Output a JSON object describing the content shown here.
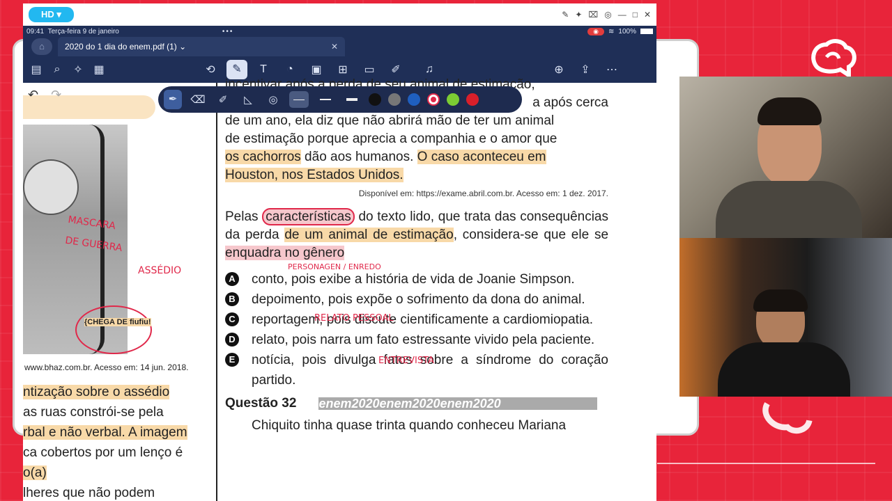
{
  "stream": {
    "hd_label": "HD ▾"
  },
  "status_bar": {
    "time": "09:41",
    "date": "Terça-feira 9 de janeiro",
    "battery": "100%"
  },
  "tab": {
    "title": "2020 do 1 dia do enem.pdf (1)"
  },
  "left_column": {
    "source": "www.bhaz.com.br. Acesso em: 14 jun. 2018.",
    "text_lines": [
      "ntização sobre o assédio",
      "as ruas constrói-se pela",
      "rbal e não verbal. A imagem",
      "ca cobertos por um lenço é",
      "o(a)",
      "lheres que não podem"
    ],
    "annotations": [
      "MASCARA DE GUERRA",
      "ASSÉDIO",
      "{CHEGA DE fiufiu!"
    ]
  },
  "passage": {
    "line1": "incentivar após a perda de seu animal de estimação,",
    "line2": "a após cerca",
    "line3": "de um ano, ela diz que não abrirá mão de ter um animal",
    "line4": "de estimação porque aprecia a companhia e o amor que",
    "line5_a": "os cachorros",
    "line5_b": " dão aos humanos. ",
    "line5_c": "O caso aconteceu em",
    "line6": "Houston, nos Estados Unidos.",
    "source": "Disponível em: https://exame.abril.com.br. Acesso em: 1 dez. 2017."
  },
  "question": {
    "part1": "Pelas ",
    "highlight1": "características",
    "part2": " do texto lido, que trata das consequências da perda ",
    "highlight2": "de um animal de estimação",
    "part3": ", considera-se que ele se ",
    "highlight3": "enquadra no gênero"
  },
  "options": [
    {
      "letter": "A",
      "text": "conto, pois exibe a história de vida de Joanie Simpson."
    },
    {
      "letter": "B",
      "text": "depoimento, pois expõe o sofrimento da dona do animal."
    },
    {
      "letter": "C",
      "text": "reportagem, pois discute cientificamente a cardiomiopatia."
    },
    {
      "letter": "D",
      "text": "relato, pois narra um fato estressante vivido pela paciente."
    },
    {
      "letter": "E",
      "text": "notícia, pois divulga fatos sobre a síndrome do coração partido."
    }
  ],
  "annotations_right": {
    "a": "PERSONAGEN / ENREDO",
    "b": "RELATO PESSOAL",
    "c": "ENTREVISTA"
  },
  "next_question": {
    "title": "Questão 32",
    "band": "enem2020enem2020enem2020",
    "first_line": "Chiquito tinha quase trinta quando conheceu Mariana"
  },
  "colors": {
    "background": "#e8243a",
    "toolbar": "#1f2f57",
    "highlight": "#f8d9a8",
    "pen_colors": [
      "#111111",
      "#777777",
      "#1f5fbf",
      "#e0284a",
      "#7ccc33",
      "#d91f2a"
    ]
  }
}
